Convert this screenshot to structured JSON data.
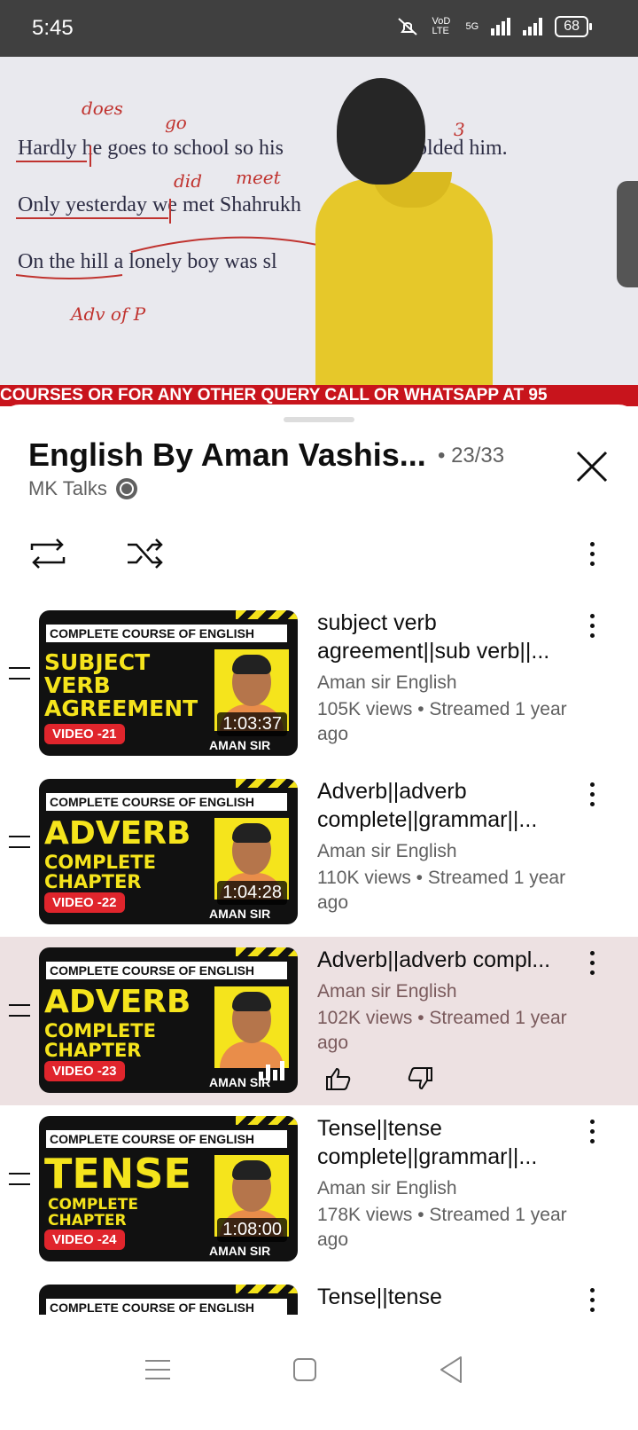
{
  "status_bar": {
    "time": "5:45",
    "network": "VoD LTE",
    "signal": "5G",
    "battery": "68"
  },
  "video": {
    "board_lines": [
      "Hardly he goes to school so his",
      "olded him.",
      "Only yesterday we met Shahrukh",
      "On the hill a lonely boy was sl"
    ],
    "annotations": [
      "does",
      "go",
      "did",
      "meet",
      "3",
      "Adv of P"
    ],
    "ticker": "COURSES OR FOR ANY OTHER QUERY CALL OR WHATSAPP AT 95"
  },
  "playlist": {
    "title": "English By Aman Vashis...",
    "position": "• 23/33",
    "owner": "MK Talks",
    "icons": {
      "owner": "globe-icon",
      "loop": "loop-icon",
      "shuffle": "shuffle-icon",
      "menu": "more-vert-icon",
      "close": "close-icon"
    }
  },
  "items": [
    {
      "thumb_header": "COMPLETE COURSE OF ENGLISH",
      "thumb_big": [
        "SUBJECT",
        "VERB",
        "AGREEMENT"
      ],
      "thumb_video": "VIDEO -21",
      "thumb_sir": "AMAN SIR",
      "duration": "1:03:37",
      "title": "subject verb agreement||sub verb||...",
      "channel": "Aman sir English",
      "meta": "105K views • Streamed 1 year ago"
    },
    {
      "thumb_header": "COMPLETE COURSE OF ENGLISH",
      "thumb_big": [
        "ADVERB"
      ],
      "thumb_sub": [
        "COMPLETE",
        "CHAPTER"
      ],
      "thumb_video": "VIDEO -22",
      "thumb_sir": "AMAN SIR",
      "duration": "1:04:28",
      "title": "Adverb||adverb complete||grammar||...",
      "channel": "Aman sir English",
      "meta": "110K views • Streamed 1 year ago"
    },
    {
      "thumb_header": "COMPLETE COURSE OF ENGLISH",
      "thumb_big": [
        "ADVERB"
      ],
      "thumb_sub": [
        "COMPLETE",
        "CHAPTER"
      ],
      "thumb_video": "VIDEO -23",
      "thumb_sir": "AMAN SIR",
      "title": "Adverb||adverb compl...",
      "channel": "Aman sir English",
      "meta": "102K views • Streamed 1 year ago",
      "active": true
    },
    {
      "thumb_header": "COMPLETE COURSE OF ENGLISH",
      "thumb_big": [
        "TENSE"
      ],
      "thumb_sub": [
        "COMPLETE",
        "CHAPTER"
      ],
      "thumb_video": "VIDEO -24",
      "thumb_sir": "AMAN SIR",
      "duration": "1:08:00",
      "title": "Tense||tense complete||grammar||...",
      "channel": "Aman sir English",
      "meta": "178K views • Streamed 1 year ago"
    },
    {
      "thumb_header": "COMPLETE COURSE OF ENGLISH",
      "title": "Tense||tense"
    }
  ],
  "nav": {
    "icons": [
      "menu-icon",
      "home-icon",
      "back-icon"
    ]
  },
  "colors": {
    "accent_active_row": "#ede1e2",
    "ticker": "#c8141c",
    "thumb_yellow": "#f5e41c",
    "video_label": "#e0252c"
  }
}
